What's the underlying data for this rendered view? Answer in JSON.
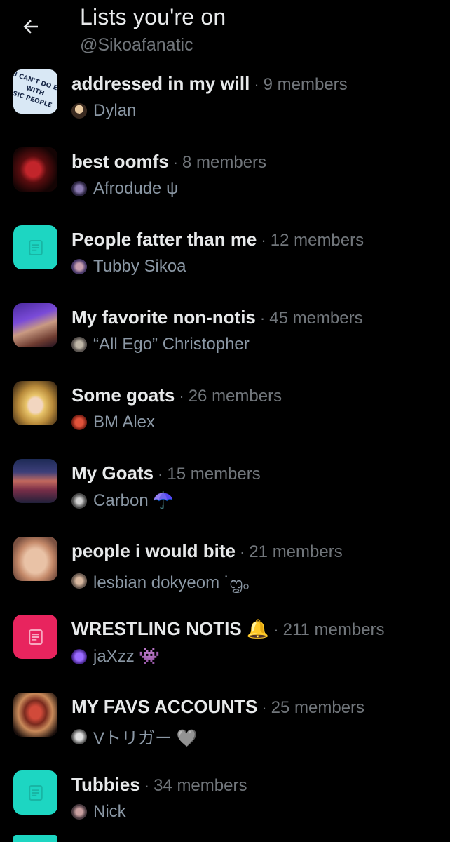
{
  "header": {
    "title": "Lists you're on",
    "handle": "@Sikoafanatic",
    "back_icon": "arrow-left-icon"
  },
  "colors": {
    "background": "#000000",
    "text_primary": "#e7e9ea",
    "text_secondary": "#71767b",
    "placeholder_teal": "#1dd6c2",
    "placeholder_pink": "#e8245e"
  },
  "lists": [
    {
      "name": "addressed in my will",
      "members": "9 members",
      "owner": "Dylan",
      "thumbnail": "image-text-graphic"
    },
    {
      "name": "best oomfs",
      "members": "8 members",
      "owner": "Afrodude ψ",
      "thumbnail": "photo-red"
    },
    {
      "name": "People fatter than me",
      "members": "12 members",
      "owner": "Tubby Sikoa",
      "thumbnail": "list-placeholder-teal"
    },
    {
      "name": "My favorite non-notis",
      "members": "45 members",
      "owner": "“All Ego” Christopher",
      "thumbnail": "photo-wrestler"
    },
    {
      "name": "Some goats",
      "members": "26 members",
      "owner": "BM Alex",
      "thumbnail": "photo-blonde"
    },
    {
      "name": "My Goats",
      "members": "15 members",
      "owner": "Carbon ☂️",
      "thumbnail": "photo-arena"
    },
    {
      "name": "people i would bite",
      "members": "21 members",
      "owner": "lesbian dokyeom ˙ᦗ。",
      "thumbnail": "photo-face"
    },
    {
      "name": "WRESTLING NOTIS 🔔",
      "members": "211 members",
      "owner": "jaXzz 👾",
      "thumbnail": "list-placeholder-pink"
    },
    {
      "name": "MY FAVS ACCOUNTS",
      "members": "25 members",
      "owner": "Vトリガー 🩶",
      "thumbnail": "photo-masked"
    },
    {
      "name": "Tubbies",
      "members": "34 members",
      "owner": "Nick",
      "thumbnail": "list-placeholder-teal"
    }
  ]
}
